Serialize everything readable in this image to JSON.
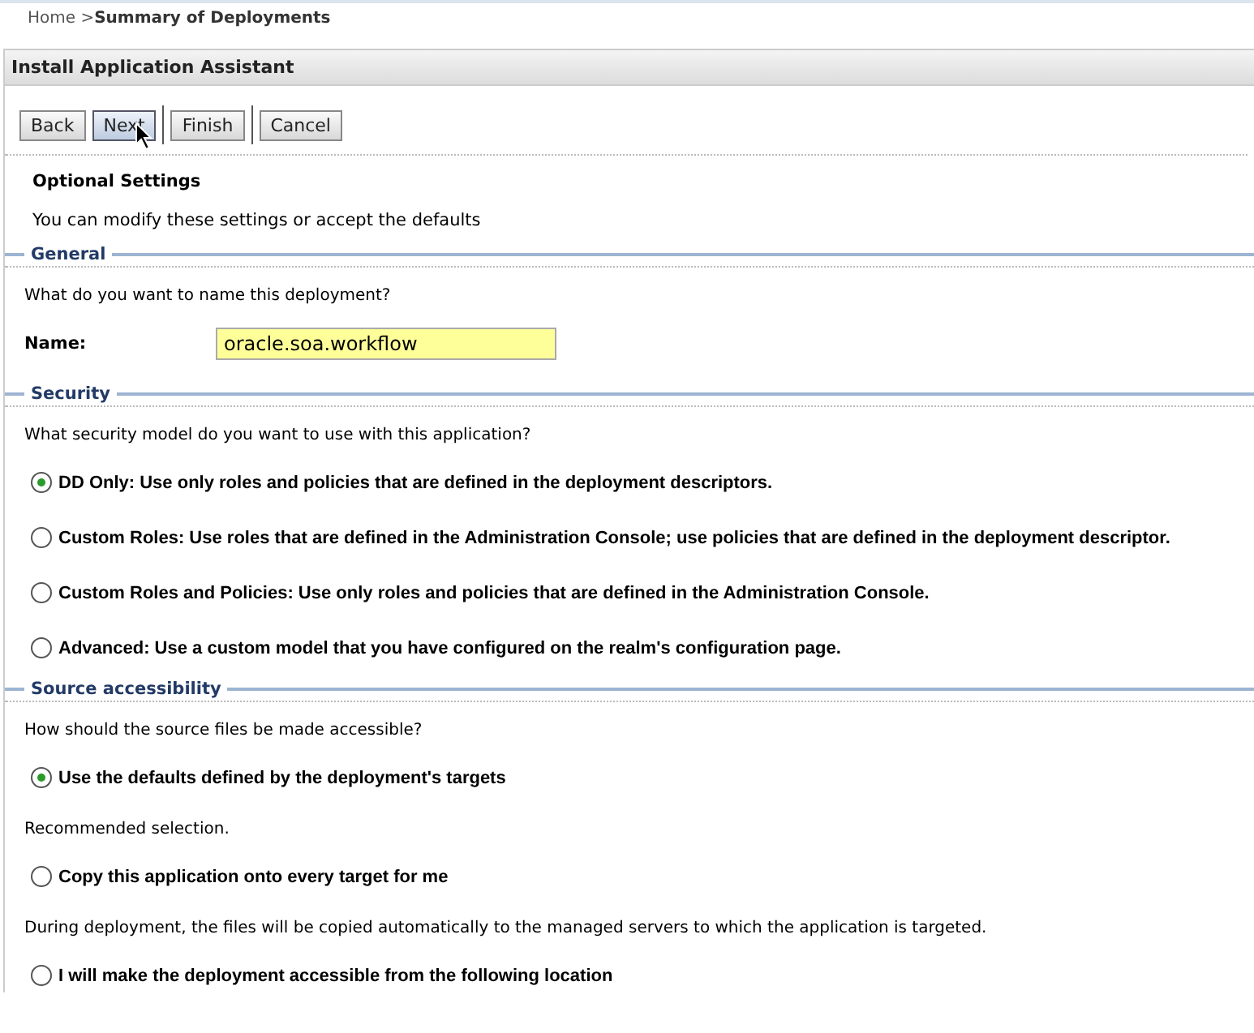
{
  "breadcrumb": {
    "home": "Home >",
    "current": "Summary of Deployments"
  },
  "panel": {
    "title": "Install Application Assistant"
  },
  "buttons": [
    {
      "label": "Back",
      "hovered": false
    },
    {
      "label": "Next",
      "hovered": true
    },
    {
      "label": "Finish",
      "hovered": false
    },
    {
      "label": "Cancel",
      "hovered": false
    }
  ],
  "page_title": "Optional Settings",
  "intro": "You can modify these settings or accept the defaults",
  "sections": [
    {
      "title": "General",
      "items": [
        {
          "kind": "prompt",
          "text": "What do you want to name this deployment?"
        },
        {
          "kind": "field",
          "label": "Name:",
          "value": "oracle.soa.workflow"
        }
      ]
    },
    {
      "title": "Security",
      "items": [
        {
          "kind": "prompt",
          "text": "What security model do you want to use with this application?"
        },
        {
          "kind": "radio",
          "text": "DD Only: Use only roles and policies that are defined in the deployment descriptors.",
          "selected": true
        },
        {
          "kind": "radio",
          "text": "Custom Roles: Use roles that are defined in the Administration Console; use policies that are defined in the deployment descriptor.",
          "selected": false
        },
        {
          "kind": "radio",
          "text": "Custom Roles and Policies: Use only roles and policies that are defined in the Administration Console.",
          "selected": false
        },
        {
          "kind": "radio",
          "text": "Advanced: Use a custom model that you have configured on the realm's configuration page.",
          "selected": false
        }
      ]
    },
    {
      "title": "Source accessibility",
      "items": [
        {
          "kind": "prompt",
          "text": "How should the source files be made accessible?"
        },
        {
          "kind": "radio",
          "text": "Use the defaults defined by the deployment's targets",
          "selected": true
        },
        {
          "kind": "note",
          "text": "Recommended selection."
        },
        {
          "kind": "radio",
          "text": "Copy this application onto every target for me",
          "selected": false
        },
        {
          "kind": "note",
          "text": "During deployment, the files will be copied automatically to the managed servers to which the application is targeted."
        },
        {
          "kind": "radio",
          "text": "I will make the deployment accessible from the following location",
          "selected": false
        }
      ]
    }
  ]
}
